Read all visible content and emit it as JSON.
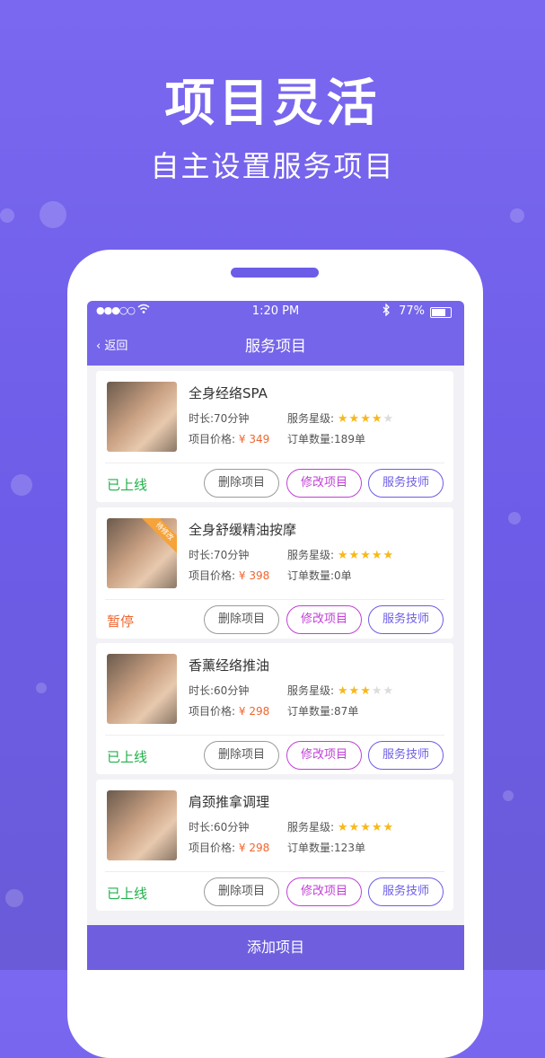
{
  "promo": {
    "headline": "项目灵活",
    "subline": "自主设置服务项目"
  },
  "status_bar": {
    "signal": "●●●○○",
    "time": "1:20 PM",
    "battery": "77%"
  },
  "nav": {
    "back_label": "返回",
    "title": "服务项目"
  },
  "colors": {
    "primary": "#6c5ce7",
    "online": "#22b14c",
    "paused": "#f0652f",
    "price": "#f0652f",
    "edit": "#c03fd6"
  },
  "items": [
    {
      "name": "全身经络SPA",
      "duration": "时长:70分钟",
      "rating_label": "服务星级:",
      "stars": 4,
      "price_label": "项目价格:",
      "price": "¥ 349",
      "orders": "订单数量:189单",
      "status": "已上线",
      "btn_delete": "删除项目",
      "btn_edit": "修改项目",
      "btn_tech": "服务技师"
    },
    {
      "name": "全身舒缓精油按摩",
      "badge": "待修改",
      "duration": "时长:70分钟",
      "rating_label": "服务星级:",
      "stars": 5,
      "price_label": "项目价格:",
      "price": "¥ 398",
      "orders": "订单数量:0单",
      "status": "暂停",
      "btn_delete": "删除项目",
      "btn_edit": "修改项目",
      "btn_tech": "服务技师"
    },
    {
      "name": "香薰经络推油",
      "duration": "时长:60分钟",
      "rating_label": "服务星级:",
      "stars": 3,
      "price_label": "项目价格:",
      "price": "¥ 298",
      "orders": "订单数量:87单",
      "status": "已上线",
      "btn_delete": "删除项目",
      "btn_edit": "修改项目",
      "btn_tech": "服务技师"
    },
    {
      "name": "肩颈推拿调理",
      "duration": "时长:60分钟",
      "rating_label": "服务星级:",
      "stars": 5,
      "price_label": "项目价格:",
      "price": "¥ 298",
      "orders": "订单数量:123单",
      "status": "已上线",
      "btn_delete": "删除项目",
      "btn_edit": "修改项目",
      "btn_tech": "服务技师"
    }
  ],
  "footer": {
    "add_label": "添加项目"
  }
}
